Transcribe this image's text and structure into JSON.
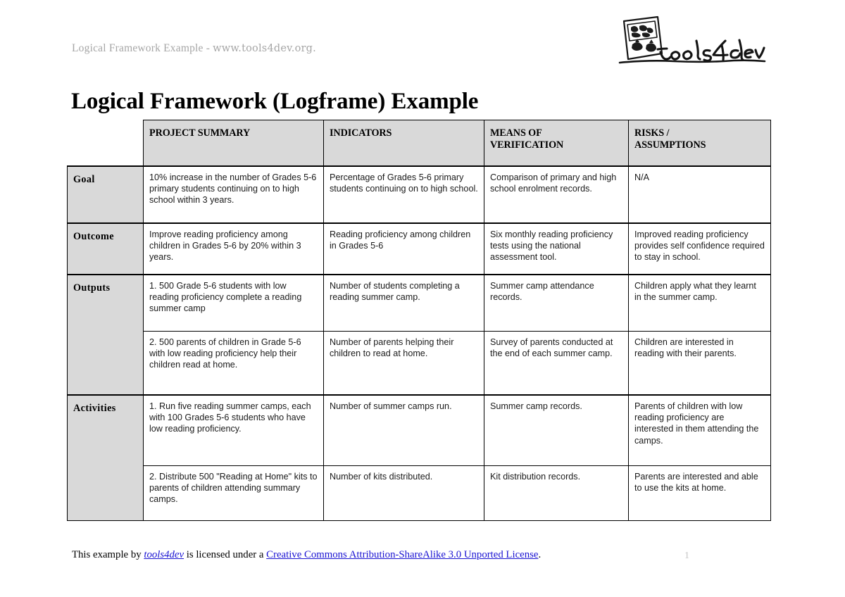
{
  "header": {
    "running_head_prefix": "Logical Framework Example - ",
    "running_head_url": "www.tools4dev.org.",
    "logo_text": "tools4dev",
    "logo_icon": "sketched-document-icon"
  },
  "title": "Logical Framework (Logframe) Example",
  "table": {
    "corner_label": "",
    "columns": [
      "PROJECT SUMMARY",
      "INDICATORS",
      "MEANS OF VERIFICATION",
      "RISKS / ASSUMPTIONS"
    ],
    "column_lines": {
      "mov_line1": "MEANS OF",
      "mov_line2": "VERIFICATION",
      "risk_line1": "RISKS /",
      "risk_line2": "ASSUMPTIONS"
    },
    "rows": [
      {
        "label": "Goal",
        "entries": [
          {
            "summary": "10% increase in the number of Grades 5-6 primary students continuing on to high school within 3 years.",
            "indicators": "Percentage of Grades 5-6 primary students continuing on to high school.",
            "verification": "Comparison of primary and high school enrolment records.",
            "risks": "N/A"
          }
        ]
      },
      {
        "label": "Outcome",
        "entries": [
          {
            "summary": "Improve reading proficiency among children in Grades 5-6 by 20% within 3 years.",
            "indicators": "Reading proficiency among children in Grades 5-6",
            "verification": "Six monthly reading proficiency tests using the national assessment tool.",
            "risks": "Improved reading proficiency provides self confidence required to stay in school."
          }
        ]
      },
      {
        "label": "Outputs",
        "entries": [
          {
            "summary": "1. 500 Grade 5-6 students with low reading proficiency complete a reading summer camp",
            "indicators": "Number of students completing a reading summer camp.",
            "verification": "Summer camp attendance records.",
            "risks": "Children apply what they learnt in the summer camp."
          },
          {
            "summary": "2. 500 parents of children in Grade 5-6 with low reading proficiency help their children read at home.",
            "indicators": "Number of parents helping their children to read at home.",
            "verification": "Survey of parents conducted at the end of each summer camp.",
            "risks": "Children are interested in reading with their parents."
          }
        ]
      },
      {
        "label": "Activities",
        "entries": [
          {
            "summary": "1. Run five reading summer camps, each with 100 Grades 5-6 students who have low reading proficiency.",
            "indicators": "Number of summer camps run.",
            "verification": "Summer camp records.",
            "risks": "Parents of children with low reading proficiency are interested in them attending the camps."
          },
          {
            "summary": "2. Distribute 500 \"Reading at Home\" kits to parents of children attending summary camps.",
            "indicators": "Number of kits distributed.",
            "verification": "Kit distribution records.",
            "risks": "Parents are interested and able to use the kits at home."
          }
        ]
      }
    ]
  },
  "footer": {
    "prefix": "This example by ",
    "brand": "tools4dev",
    "middle": " is licensed under a ",
    "license": "Creative Commons Attribution-ShareAlike 3.0 Unported License",
    "suffix": ".",
    "page_number": "1"
  },
  "colors": {
    "header_fill": "#d9d9d9",
    "border": "#000000",
    "link": "#1a13d2",
    "running_head": "#a6a6a6",
    "page_number": "#c6c6c6"
  }
}
